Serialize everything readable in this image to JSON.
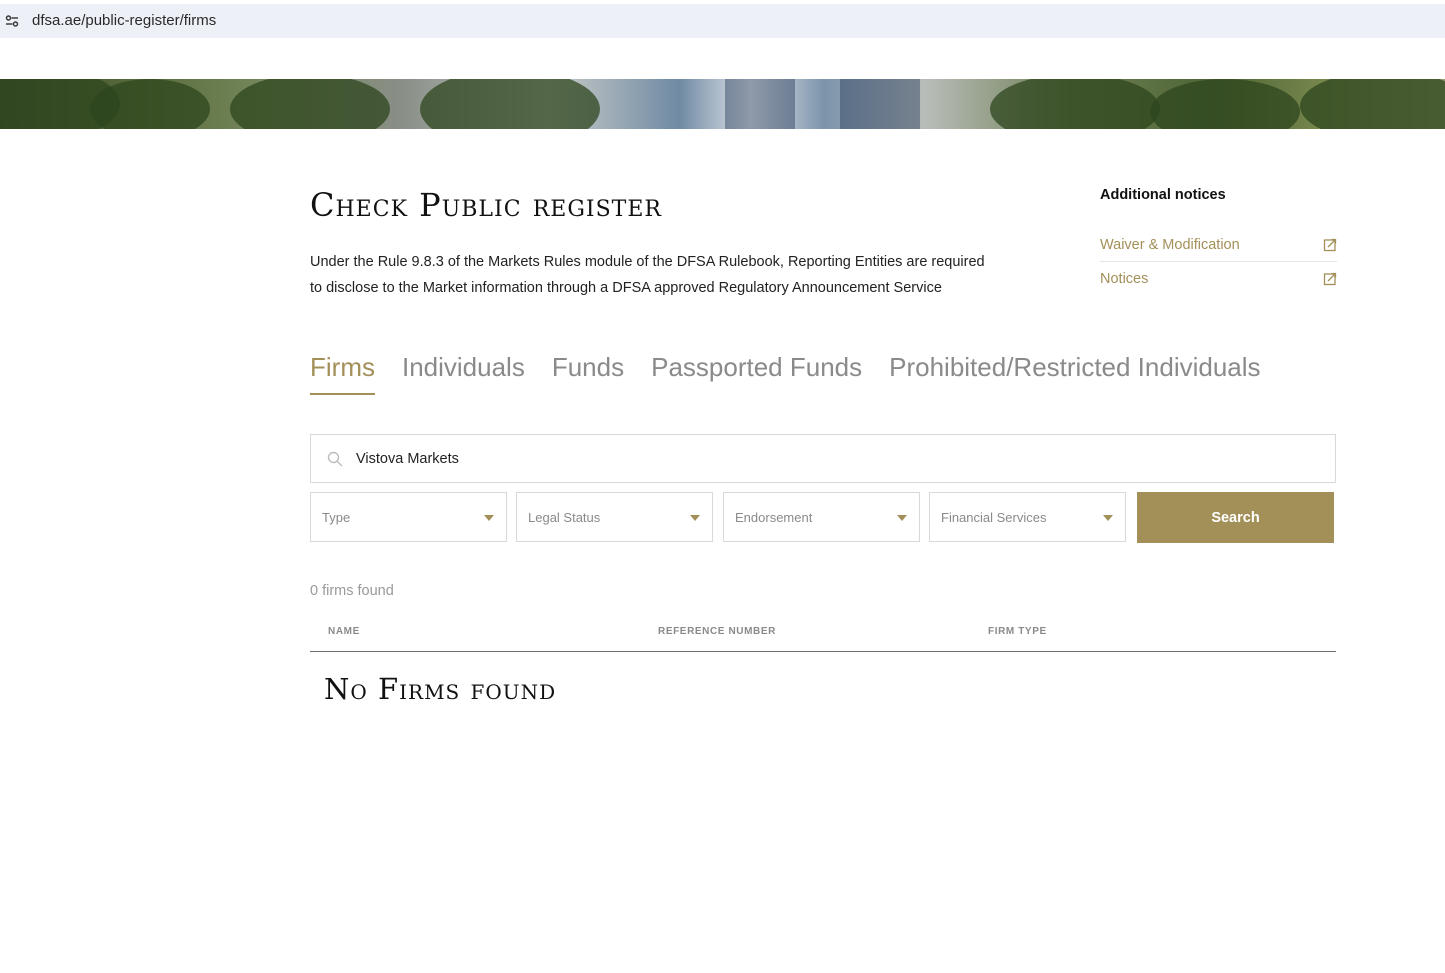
{
  "browser": {
    "url": "dfsa.ae/public-register/firms"
  },
  "page": {
    "title": "Check Public register",
    "intro": "Under the Rule 9.8.3 of the Markets Rules module of the DFSA Rulebook, Reporting Entities are required to disclose to the Market information through a DFSA approved Regulatory Announcement Service"
  },
  "notices": {
    "title": "Additional notices",
    "items": [
      {
        "label": "Waiver & Modification",
        "icon": "external-link-icon"
      },
      {
        "label": "Notices",
        "icon": "external-link-icon"
      }
    ]
  },
  "tabs": [
    {
      "label": "Firms",
      "active": true
    },
    {
      "label": "Individuals",
      "active": false
    },
    {
      "label": "Funds",
      "active": false
    },
    {
      "label": "Passported Funds",
      "active": false
    },
    {
      "label": "Prohibited/Restricted Individuals",
      "active": false
    }
  ],
  "search": {
    "value": "Vistova Markets",
    "icon": "search-icon",
    "button_label": "Search"
  },
  "filters": [
    {
      "label": "Type"
    },
    {
      "label": "Legal Status"
    },
    {
      "label": "Endorsement"
    },
    {
      "label": "Financial Services"
    }
  ],
  "results": {
    "count_text": "0 firms found",
    "columns": [
      "NAME",
      "REFERENCE NUMBER",
      "FIRM TYPE"
    ],
    "empty_text": "No Firms found"
  },
  "colors": {
    "accent": "#a39059",
    "muted_text": "#8a8a8a"
  }
}
